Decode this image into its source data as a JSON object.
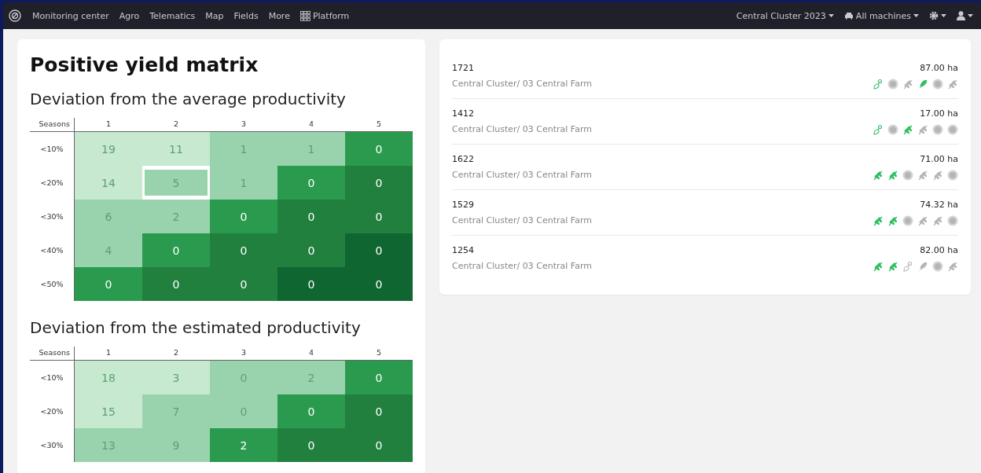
{
  "nav": {
    "items": [
      "Monitoring center",
      "Agro",
      "Telematics",
      "Map",
      "Fields",
      "More"
    ],
    "platform": "Platform",
    "season": "Central Cluster 2023",
    "machines": "All machines"
  },
  "title": "Positive yield matrix",
  "matrices": [
    {
      "subtitle": "Deviation from the average productivity",
      "corner": "Seasons",
      "columns": [
        "1",
        "2",
        "3",
        "4",
        "5"
      ],
      "rows": [
        {
          "label": "<10%",
          "cells": [
            {
              "value": "19",
              "color": "#c7e9d0",
              "selected": false
            },
            {
              "value": "11",
              "color": "#c7e9d0",
              "selected": false
            },
            {
              "value": "1",
              "color": "#98d3ad",
              "selected": false
            },
            {
              "value": "1",
              "color": "#98d3ad",
              "selected": false
            },
            {
              "value": "0",
              "color": "#2a9a4e",
              "selected": false
            }
          ]
        },
        {
          "label": "<20%",
          "cells": [
            {
              "value": "14",
              "color": "#c7e9d0",
              "selected": false
            },
            {
              "value": "5",
              "color": "#98d3ad",
              "selected": true
            },
            {
              "value": "1",
              "color": "#98d3ad",
              "selected": false
            },
            {
              "value": "0",
              "color": "#2a9a4e",
              "selected": false
            },
            {
              "value": "0",
              "color": "#22803f",
              "selected": false
            }
          ]
        },
        {
          "label": "<30%",
          "cells": [
            {
              "value": "6",
              "color": "#98d3ad",
              "selected": false
            },
            {
              "value": "2",
              "color": "#98d3ad",
              "selected": false
            },
            {
              "value": "0",
              "color": "#2a9a4e",
              "selected": false
            },
            {
              "value": "0",
              "color": "#22803f",
              "selected": false
            },
            {
              "value": "0",
              "color": "#22803f",
              "selected": false
            }
          ]
        },
        {
          "label": "<40%",
          "cells": [
            {
              "value": "4",
              "color": "#98d3ad",
              "selected": false
            },
            {
              "value": "0",
              "color": "#2a9a4e",
              "selected": false
            },
            {
              "value": "0",
              "color": "#22803f",
              "selected": false
            },
            {
              "value": "0",
              "color": "#22803f",
              "selected": false
            },
            {
              "value": "0",
              "color": "#0f6630",
              "selected": false
            }
          ]
        },
        {
          "label": "<50%",
          "cells": [
            {
              "value": "0",
              "color": "#2a9a4e",
              "selected": false
            },
            {
              "value": "0",
              "color": "#22803f",
              "selected": false
            },
            {
              "value": "0",
              "color": "#22803f",
              "selected": false
            },
            {
              "value": "0",
              "color": "#0f6630",
              "selected": false
            },
            {
              "value": "0",
              "color": "#0f6630",
              "selected": false
            }
          ]
        }
      ]
    },
    {
      "subtitle": "Deviation from the estimated productivity",
      "corner": "Seasons",
      "columns": [
        "1",
        "2",
        "3",
        "4",
        "5"
      ],
      "rows": [
        {
          "label": "<10%",
          "cells": [
            {
              "value": "18",
              "color": "#c7e9d0",
              "selected": false
            },
            {
              "value": "3",
              "color": "#c7e9d0",
              "selected": false
            },
            {
              "value": "0",
              "color": "#98d3ad",
              "selected": false
            },
            {
              "value": "2",
              "color": "#98d3ad",
              "selected": false
            },
            {
              "value": "0",
              "color": "#2a9a4e",
              "selected": false
            }
          ]
        },
        {
          "label": "<20%",
          "cells": [
            {
              "value": "15",
              "color": "#c7e9d0",
              "selected": false
            },
            {
              "value": "7",
              "color": "#98d3ad",
              "selected": false
            },
            {
              "value": "0",
              "color": "#98d3ad",
              "selected": false
            },
            {
              "value": "0",
              "color": "#2a9a4e",
              "selected": false
            },
            {
              "value": "0",
              "color": "#22803f",
              "selected": false
            }
          ]
        },
        {
          "label": "<30%",
          "cells": [
            {
              "value": "13",
              "color": "#98d3ad",
              "selected": false
            },
            {
              "value": "9",
              "color": "#98d3ad",
              "selected": false
            },
            {
              "value": "2",
              "color": "#2a9a4e",
              "selected": false
            },
            {
              "value": "0",
              "color": "#22803f",
              "selected": false
            },
            {
              "value": "0",
              "color": "#22803f",
              "selected": false
            }
          ]
        }
      ]
    }
  ],
  "fields": [
    {
      "name": "1721",
      "location": "Central Cluster/ 03 Central Farm",
      "area": "87.00 ha",
      "crops": [
        {
          "kind": "beet",
          "active": true
        },
        {
          "kind": "sunflower",
          "active": false
        },
        {
          "kind": "wheat",
          "active": false
        },
        {
          "kind": "corn",
          "active": true
        },
        {
          "kind": "sunflower",
          "active": false
        },
        {
          "kind": "wheat",
          "active": false
        }
      ]
    },
    {
      "name": "1412",
      "location": "Central Cluster/ 03 Central Farm",
      "area": "17.00 ha",
      "crops": [
        {
          "kind": "beet",
          "active": true
        },
        {
          "kind": "sunflower",
          "active": false
        },
        {
          "kind": "wheat",
          "active": true
        },
        {
          "kind": "wheat",
          "active": false
        },
        {
          "kind": "sunflower",
          "active": false
        },
        {
          "kind": "sunflower",
          "active": false
        }
      ]
    },
    {
      "name": "1622",
      "location": "Central Cluster/ 03 Central Farm",
      "area": "71.00 ha",
      "crops": [
        {
          "kind": "wheat",
          "active": true
        },
        {
          "kind": "wheat",
          "active": true
        },
        {
          "kind": "sunflower",
          "active": false
        },
        {
          "kind": "wheat",
          "active": false
        },
        {
          "kind": "wheat",
          "active": false
        },
        {
          "kind": "sunflower",
          "active": false
        }
      ]
    },
    {
      "name": "1529",
      "location": "Central Cluster/ 03 Central Farm",
      "area": "74.32 ha",
      "crops": [
        {
          "kind": "wheat",
          "active": true
        },
        {
          "kind": "wheat",
          "active": true
        },
        {
          "kind": "sunflower",
          "active": false
        },
        {
          "kind": "wheat",
          "active": false
        },
        {
          "kind": "wheat",
          "active": false
        },
        {
          "kind": "sunflower",
          "active": false
        }
      ]
    },
    {
      "name": "1254",
      "location": "Central Cluster/ 03 Central Farm",
      "area": "82.00 ha",
      "crops": [
        {
          "kind": "wheat",
          "active": true
        },
        {
          "kind": "wheat",
          "active": true
        },
        {
          "kind": "beet",
          "active": false
        },
        {
          "kind": "corn",
          "active": false
        },
        {
          "kind": "sunflower",
          "active": false
        },
        {
          "kind": "wheat",
          "active": false
        }
      ]
    }
  ]
}
